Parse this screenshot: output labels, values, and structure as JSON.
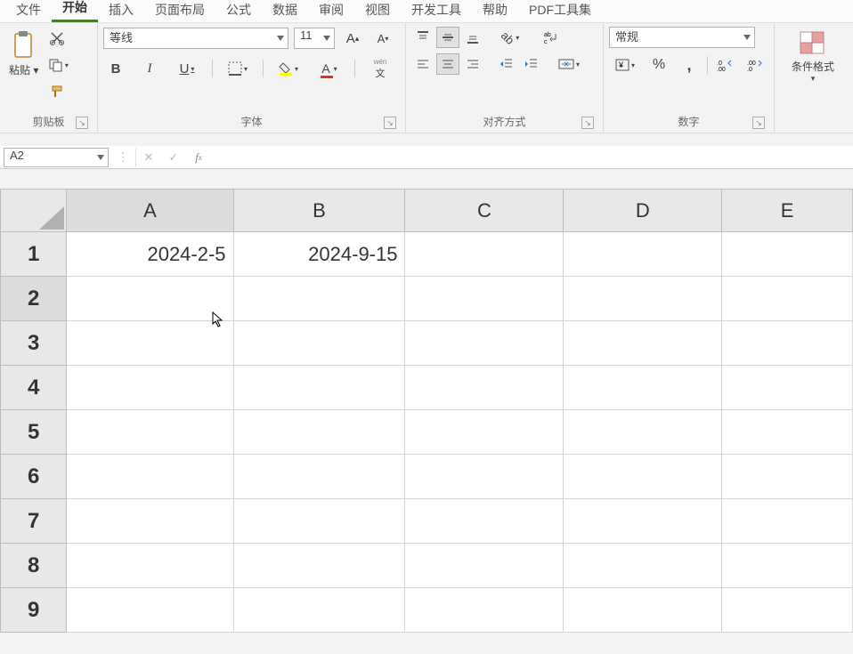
{
  "menu": {
    "items": [
      "文件",
      "开始",
      "插入",
      "页面布局",
      "公式",
      "数据",
      "审阅",
      "视图",
      "开发工具",
      "帮助",
      "PDF工具集"
    ],
    "active_index": 1
  },
  "ribbon": {
    "clipboard": {
      "paste_label": "粘贴",
      "group_label": "剪贴板"
    },
    "font": {
      "font_name": "等线",
      "font_size": "11",
      "group_label": "字体",
      "bold": "B",
      "italic": "I",
      "underline": "U"
    },
    "alignment": {
      "group_label": "对齐方式"
    },
    "number": {
      "format_value": "常规",
      "group_label": "数字"
    },
    "styles": {
      "condfmt_label": "条件格式"
    }
  },
  "formula_bar": {
    "name_box": "A2",
    "formula": ""
  },
  "grid": {
    "columns": [
      "A",
      "B",
      "C",
      "D",
      "E"
    ],
    "rows": [
      "1",
      "2",
      "3",
      "4",
      "5",
      "6",
      "7",
      "8",
      "9"
    ],
    "cells": {
      "A1": "2024-2-5",
      "B1": "2024-9-15"
    },
    "active_cell": "A2"
  }
}
